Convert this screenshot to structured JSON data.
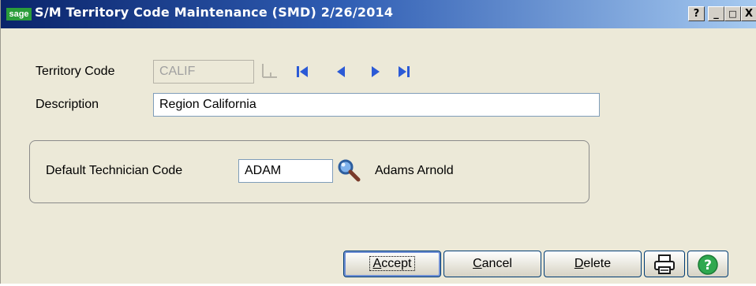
{
  "window": {
    "logo": "sage",
    "title": "S/M Territory Code Maintenance (SMD) 2/26/2014",
    "help_button": "?",
    "minimize_button": "_",
    "maximize_button": "□",
    "close_button": "X"
  },
  "form": {
    "territory_label": "Territory Code",
    "territory_value": "CALIF",
    "description_label": "Description",
    "description_value": "Region California",
    "technician_label": "Default Technician Code",
    "technician_value": "ADAM",
    "technician_name": "Adams Arnold"
  },
  "buttons": {
    "accept": {
      "mnemonic": "A",
      "rest": "ccept"
    },
    "cancel": {
      "mnemonic": "C",
      "rest": "ancel"
    },
    "delete": {
      "mnemonic": "D",
      "rest": "elete"
    }
  },
  "icons": {
    "nav": [
      "first-record-icon",
      "previous-record-icon",
      "next-record-icon",
      "last-record-icon"
    ],
    "lookup": "magnifier-icon",
    "print": "printer-icon",
    "help": "help-icon"
  },
  "colors": {
    "nav_blue": "#2b5ad6",
    "help_green": "#2fa84f"
  }
}
